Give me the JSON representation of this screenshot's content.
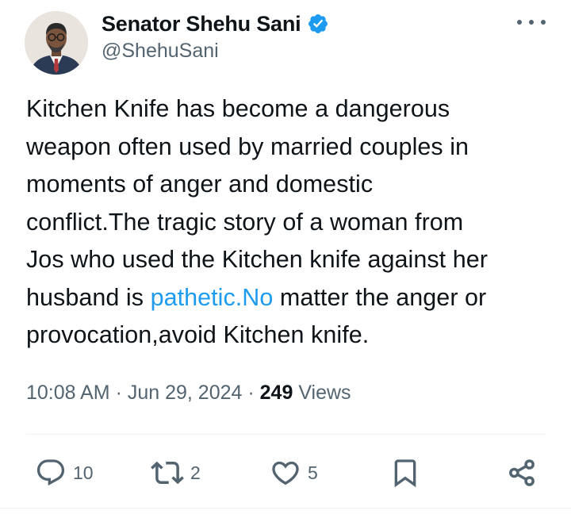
{
  "author": {
    "display_name": "Senator Shehu Sani",
    "handle": "@ShehuSani"
  },
  "tweet": {
    "lines": [
      "Kitchen Knife has become a dangerous",
      "weapon often used by married couples in",
      "moments of anger and domestic",
      "conflict.The tragic story of a woman from",
      "Jos who used the Kitchen knife against her"
    ],
    "line6_before": "husband is ",
    "line6_link": "pathetic.No",
    "line6_after": " matter the anger or",
    "line7": "provocation,avoid Kitchen knife."
  },
  "meta": {
    "time": "10:08 AM",
    "sep1": " · ",
    "date": "Jun 29, 2024",
    "sep2": " · ",
    "views_count": "249",
    "views_label": " Views"
  },
  "actions": {
    "replies": "10",
    "reposts": "2",
    "likes": "5"
  },
  "colors": {
    "text": "#0f1419",
    "secondary": "#536471",
    "link": "#1d9bf0",
    "verified": "#1d9bf0"
  },
  "icons": {
    "verified": "verified-badge-icon",
    "more": "more-horizontal-icon",
    "reply": "reply-icon",
    "repost": "repost-icon",
    "like": "heart-icon",
    "bookmark": "bookmark-icon",
    "share": "share-icon"
  }
}
